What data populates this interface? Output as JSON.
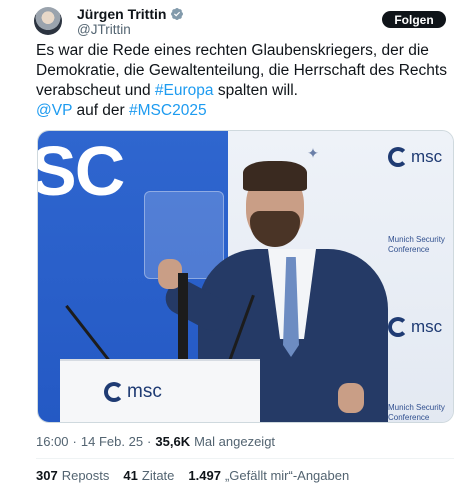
{
  "author": {
    "name": "Jürgen Trittin",
    "handle": "@JTrittin"
  },
  "follow_label": "Folgen",
  "tweet": {
    "line1": "Es war die Rede eines rechten Glaubenskriegers, der die",
    "line2": "Demokratie, die Gewaltenteilung, die Herrschaft des Rechts",
    "line3_pre": "verabscheut und ",
    "line3_tag": "#Europa",
    "line3_post": " spalten will.",
    "line4_mention": "@VP",
    "line4_mid": " auf der ",
    "line4_tag": "#MSC2025"
  },
  "media": {
    "big_text": "SC",
    "logo_text": "msc",
    "caption": "Munich Security Conference"
  },
  "meta": {
    "time": "16:00",
    "sep1": "·",
    "date": "14 Feb. 25",
    "sep2": "·",
    "views": "35,6K",
    "views_label": "Mal angezeigt"
  },
  "stats": {
    "reposts_count": "307",
    "reposts_label": "Reposts",
    "quotes_count": "41",
    "quotes_label": "Zitate",
    "likes_count": "1.497",
    "likes_label": "„Gefällt mir“-Angaben"
  },
  "colors": {
    "link": "#1d9bf0",
    "verified": "#829aab",
    "msc_blue": "#2459c4"
  }
}
